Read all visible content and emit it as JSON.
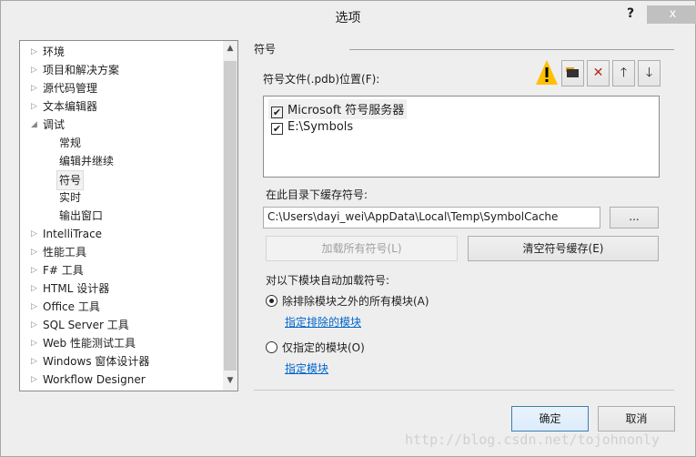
{
  "window": {
    "title": "选项",
    "help": "?",
    "close": "x"
  },
  "tree": {
    "items": [
      {
        "label": "环境",
        "level": 0,
        "state": "collapsed"
      },
      {
        "label": "项目和解决方案",
        "level": 0,
        "state": "collapsed"
      },
      {
        "label": "源代码管理",
        "level": 0,
        "state": "collapsed"
      },
      {
        "label": "文本编辑器",
        "level": 0,
        "state": "collapsed"
      },
      {
        "label": "调试",
        "level": 0,
        "state": "expanded"
      },
      {
        "label": "常规",
        "level": 1
      },
      {
        "label": "编辑并继续",
        "level": 1
      },
      {
        "label": "符号",
        "level": 1,
        "selected": true
      },
      {
        "label": "实时",
        "level": 1
      },
      {
        "label": "输出窗口",
        "level": 1
      },
      {
        "label": "IntelliTrace",
        "level": 0,
        "state": "collapsed"
      },
      {
        "label": "性能工具",
        "level": 0,
        "state": "collapsed"
      },
      {
        "label": "F# 工具",
        "level": 0,
        "state": "collapsed"
      },
      {
        "label": "HTML 设计器",
        "level": 0,
        "state": "collapsed"
      },
      {
        "label": "Office 工具",
        "level": 0,
        "state": "collapsed"
      },
      {
        "label": "SQL Server 工具",
        "level": 0,
        "state": "collapsed"
      },
      {
        "label": "Web 性能测试工具",
        "level": 0,
        "state": "collapsed"
      },
      {
        "label": "Windows 窗体设计器",
        "level": 0,
        "state": "collapsed"
      },
      {
        "label": "Workflow Designer",
        "level": 0,
        "state": "collapsed"
      }
    ]
  },
  "panel": {
    "section_title": "符号",
    "locations_label": "符号文件(.pdb)位置(F):",
    "toolbar": [
      "warning-icon",
      "new-folder-icon",
      "delete-icon",
      "arrow-up-icon",
      "arrow-down-icon"
    ],
    "locations": [
      {
        "label": "Microsoft 符号服务器",
        "checked": true
      },
      {
        "label": "E:\\Symbols",
        "checked": true
      }
    ],
    "cache_label": "在此目录下缓存符号:",
    "cache_path": "C:\\Users\\dayi_wei\\AppData\\Local\\Temp\\SymbolCache",
    "browse": "...",
    "load_all": "加载所有符号(L)",
    "clear_cache": "清空符号缓存(E)",
    "auto_load_label": "对以下模块自动加载符号:",
    "radio_all": "除排除模块之外的所有模块(A)",
    "link_excluded": "指定排除的模块",
    "radio_only": "仅指定的模块(O)",
    "link_specified": "指定模块"
  },
  "footer": {
    "ok": "确定",
    "cancel": "取消"
  },
  "watermark": "http://blog.csdn.net/tojohnonly",
  "colors": {
    "link": "#0066cc",
    "warning": "#ffc000",
    "delete": "#b0281c"
  }
}
